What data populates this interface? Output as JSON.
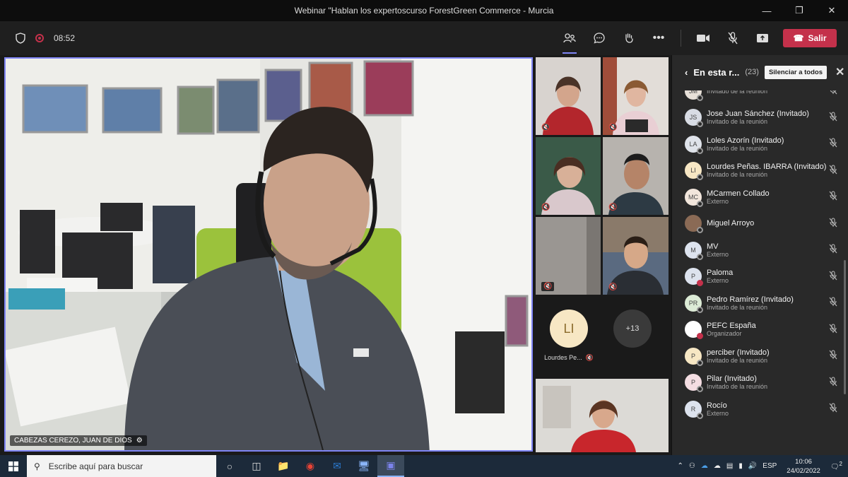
{
  "window": {
    "title": "Webinar \"Hablan los expertoscurso ForestGreen Commerce - Murcia"
  },
  "meeting": {
    "timer": "08:52",
    "leave_label": "Salir"
  },
  "main_video": {
    "speaker_name": "CABEZAS CEREZO, JUAN DE DIOS"
  },
  "gallery": {
    "avatar_initials": "LI",
    "avatar_name": "Lourdes Pe...",
    "more_count": "+13"
  },
  "panel": {
    "title": "En esta r...",
    "count": "(23)",
    "mute_all_label": "Silenciar a todos",
    "participants": [
      {
        "initials": "JM",
        "name": "",
        "role": "Invitado de la reunión",
        "color": "#e7e0d8"
      },
      {
        "initials": "JS",
        "name": "Jose Juan Sánchez (Invitado)",
        "role": "Invitado de la reunión",
        "color": "#d8dce4"
      },
      {
        "initials": "LA",
        "name": "Loles Azorín (Invitado)",
        "role": "Invitado de la reunión",
        "color": "#dfe3ea"
      },
      {
        "initials": "LI",
        "name": "Lourdes Peñas. IBARRA (Invitado)",
        "role": "Invitado de la reunión",
        "color": "#f7e7c4"
      },
      {
        "initials": "MC",
        "name": "MCarmen Collado",
        "role": "Externo",
        "color": "#f2e6dc"
      },
      {
        "initials": "",
        "name": "Miguel Arroyo",
        "role": "",
        "color": "#8a6a55"
      },
      {
        "initials": "M",
        "name": "MV",
        "role": "Externo",
        "color": "#dde3ee"
      },
      {
        "initials": "P",
        "name": "Paloma",
        "role": "Externo",
        "color": "#dde3ee"
      },
      {
        "initials": "PR",
        "name": "Pedro Ramírez (Invitado)",
        "role": "Invitado de la reunión",
        "color": "#dcebd6"
      },
      {
        "initials": "",
        "name": "PEFC España",
        "role": "Organizador",
        "color": "#ffffff"
      },
      {
        "initials": "P",
        "name": "perciber (Invitado)",
        "role": "Invitado de la reunión",
        "color": "#f7e7c4"
      },
      {
        "initials": "P",
        "name": "Pilar (Invitado)",
        "role": "Invitado de la reunión",
        "color": "#f4dde2"
      },
      {
        "initials": "R",
        "name": "Rocío",
        "role": "Externo",
        "color": "#dde3ee"
      }
    ]
  },
  "taskbar": {
    "search_placeholder": "Escribe aquí para buscar",
    "lang": "ESP",
    "time": "10:06",
    "date": "24/02/2022",
    "notif_count": "2"
  }
}
